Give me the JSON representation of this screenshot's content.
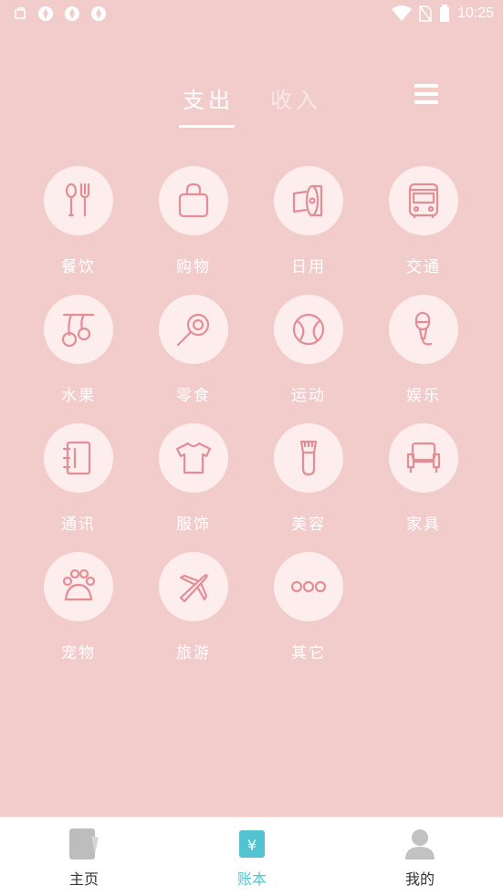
{
  "status_bar": {
    "time": "10:25",
    "left_icons": [
      "gallery-icon",
      "app-icon",
      "app-icon",
      "app-icon"
    ],
    "right_icons": [
      "wifi-icon",
      "no-sim-icon",
      "battery-icon"
    ]
  },
  "tabs": [
    {
      "label": "支出",
      "selected": true
    },
    {
      "label": "收入",
      "selected": false
    }
  ],
  "menu_icon": "menu-icon",
  "categories": [
    {
      "label": "餐饮",
      "icon": "utensils-icon"
    },
    {
      "label": "购物",
      "icon": "shopping-bag-icon"
    },
    {
      "label": "日用",
      "icon": "toilet-paper-icon"
    },
    {
      "label": "交通",
      "icon": "bus-icon"
    },
    {
      "label": "水果",
      "icon": "cherry-icon"
    },
    {
      "label": "零食",
      "icon": "lollipop-icon"
    },
    {
      "label": "运动",
      "icon": "ball-icon"
    },
    {
      "label": "娱乐",
      "icon": "microphone-icon"
    },
    {
      "label": "通讯",
      "icon": "address-book-icon"
    },
    {
      "label": "服饰",
      "icon": "tshirt-icon"
    },
    {
      "label": "美容",
      "icon": "makeup-brush-icon"
    },
    {
      "label": "家具",
      "icon": "armchair-icon"
    },
    {
      "label": "宠物",
      "icon": "paw-icon"
    },
    {
      "label": "旅游",
      "icon": "airplane-icon"
    },
    {
      "label": "其它",
      "icon": "more-icon"
    }
  ],
  "bottom_nav": [
    {
      "label": "主页",
      "icon": "home-notebook-icon",
      "active": false
    },
    {
      "label": "账本",
      "icon": "ledger-icon",
      "active": true
    },
    {
      "label": "我的",
      "icon": "user-icon",
      "active": false
    }
  ],
  "colors": {
    "background": "#F2CBCB",
    "icon_circle": "#FDEDED",
    "icon_stroke": "#E38E95",
    "accent": "#54C3D1"
  }
}
